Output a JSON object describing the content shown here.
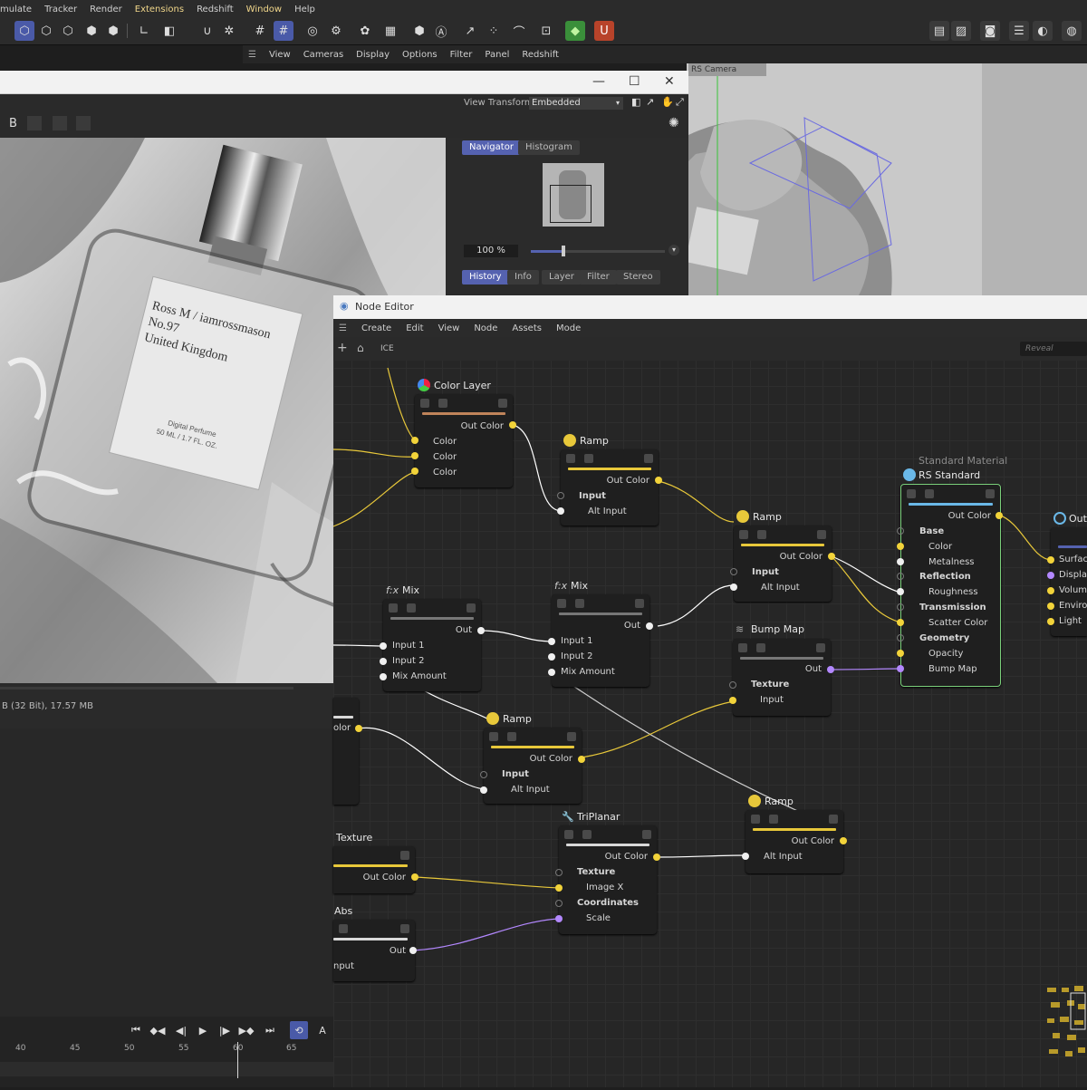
{
  "main_menu": [
    "mulate",
    "Tracker",
    "Render",
    "Extensions",
    "Redshift",
    "Window",
    "Help"
  ],
  "viewport": {
    "menu": [
      "View",
      "Cameras",
      "Display",
      "Options",
      "Filter",
      "Panel",
      "Redshift"
    ],
    "camera_tag": "RS Camera"
  },
  "picture_viewer": {
    "view_transform_label": "View Transform",
    "view_transform_value": "Embedded",
    "toolbar_b": "B",
    "tabs_top": [
      "Navigator",
      "Histogram"
    ],
    "zoom": "100 %",
    "tabs_bottom": [
      "History",
      "Info",
      "Layer",
      "Filter",
      "Stereo"
    ],
    "status": "B (32 Bit), 17.57 MB",
    "label_lines": [
      "Ross M / iamrossmason",
      "No.97",
      "United Kingdom"
    ],
    "label_small": [
      "Digital Perfume",
      "50 ML / 1.7 FL. OZ."
    ]
  },
  "node_editor": {
    "title": "Node Editor",
    "menu": [
      "Create",
      "Edit",
      "View",
      "Node",
      "Assets",
      "Mode"
    ],
    "path": "ICE",
    "search_placeholder": "Reveal",
    "nodes": {
      "color_layer": {
        "title": "Color Layer",
        "out": "Out Color",
        "inputs": [
          "Color",
          "Color",
          "Color"
        ]
      },
      "ramp1": {
        "title": "Ramp",
        "out": "Out Color",
        "group": "Input",
        "input": "Alt Input"
      },
      "ramp2": {
        "title": "Ramp",
        "out": "Out Color",
        "group": "Input",
        "input": "Alt Input"
      },
      "mix1": {
        "title": "Mix",
        "out": "Out",
        "inputs": [
          "Input 1",
          "Input 2",
          "Mix Amount"
        ]
      },
      "mix2": {
        "title": "Mix",
        "out": "Out",
        "inputs": [
          "Input 1",
          "Input 2",
          "Mix Amount"
        ]
      },
      "bump": {
        "title": "Bump Map",
        "out": "Out",
        "group": "Texture",
        "input": "Input"
      },
      "ramp3": {
        "title": "Ramp",
        "out": "Out Color",
        "group": "Input",
        "input": "Alt Input"
      },
      "triplanar": {
        "title": "TriPlanar",
        "out": "Out Color",
        "group1": "Texture",
        "input1": "Image X",
        "group2": "Coordinates",
        "input2": "Scale"
      },
      "ramp4": {
        "title": "Ramp",
        "out": "Out Color",
        "input": "Alt Input"
      },
      "texture": {
        "title": "Texture",
        "out": "Out Color"
      },
      "abs": {
        "title": "Abs",
        "out": "Out",
        "input": "nput"
      },
      "left_partial": {
        "out": "olor"
      },
      "rs_standard": {
        "subtitle": "Standard Material",
        "title": "RS Standard",
        "out": "Out Color",
        "groups": [
          {
            "name": "Base",
            "items": [
              "Color",
              "Metalness"
            ]
          },
          {
            "name": "Reflection",
            "items": [
              "Roughness"
            ]
          },
          {
            "name": "Transmission",
            "items": [
              "Scatter Color"
            ]
          },
          {
            "name": "Geometry",
            "items": [
              "Opacity",
              "Bump Map"
            ]
          }
        ]
      },
      "output": {
        "title": "Out",
        "inputs": [
          "Surface",
          "Displac",
          "Volume",
          "Environ",
          "Light"
        ]
      }
    }
  },
  "timeline": {
    "ticks": [
      "40",
      "45",
      "50",
      "55",
      "60",
      "65"
    ]
  },
  "colors": {
    "accent_blue": "#5562b0",
    "wire_yellow": "#e8c83a",
    "wire_purple": "#b388ff",
    "selection_green": "#7bd07b"
  }
}
